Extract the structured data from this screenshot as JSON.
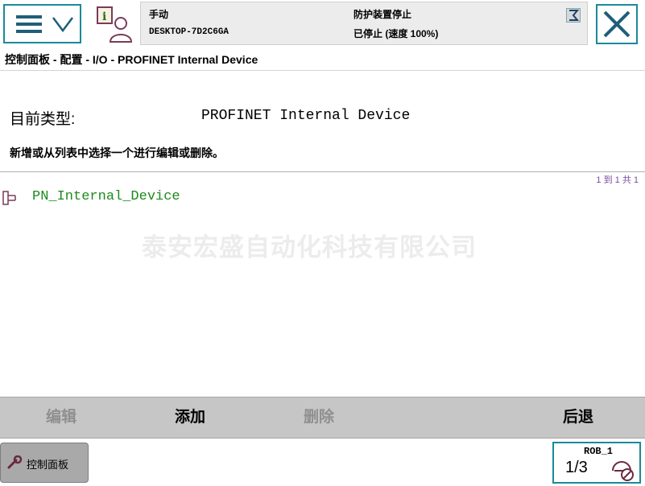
{
  "status": {
    "mode": "手动",
    "system_name": "DESKTOP-7D2C6GA",
    "guard_status": "防护装置停止",
    "run_status": "已停止 (速度 100%)"
  },
  "breadcrumb": "控制面板 - 配置 - I/O - PROFINET Internal Device",
  "content": {
    "type_label": "目前类型:",
    "type_value": "PROFINET Internal Device",
    "instruction": "新增或从列表中选择一个进行编辑或删除。",
    "pager": "1 到 1 共 1",
    "items": [
      {
        "name": "PN_Internal_Device"
      }
    ],
    "watermark": "泰安宏盛自动化科技有限公司"
  },
  "commands": {
    "edit": "编辑",
    "add": "添加",
    "delete": "删除",
    "back": "后退"
  },
  "taskbar": {
    "control_panel": "控制面板"
  },
  "quickset": {
    "robot": "ROB_1",
    "task_fraction": "1/3"
  },
  "colors": {
    "accent": "#1a8a9a",
    "item_green": "#1d8a1d",
    "pager_purple": "#7b4aa0",
    "command_bar": "#c6c6c6"
  }
}
